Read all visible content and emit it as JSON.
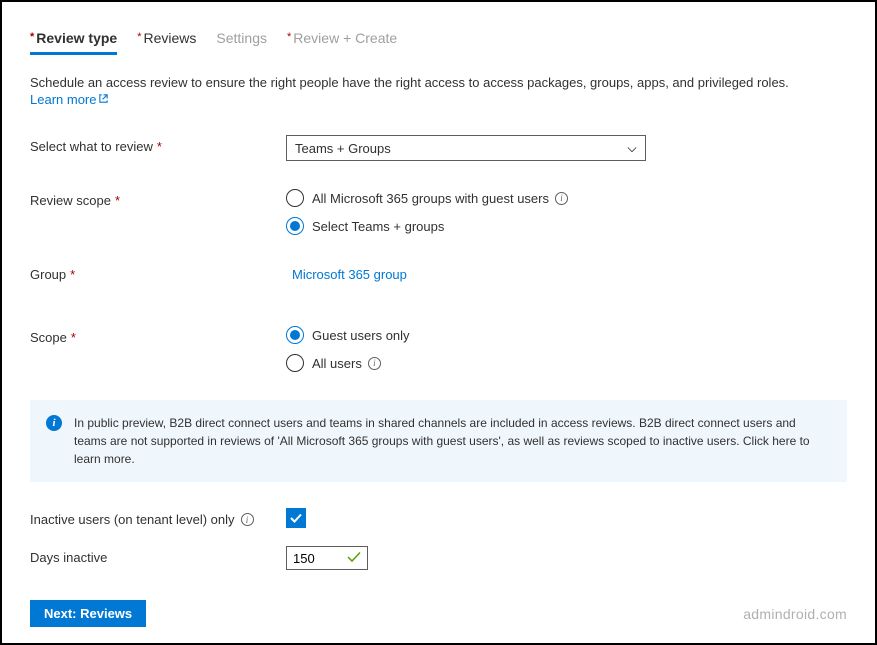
{
  "tabs": {
    "review_type": "Review type",
    "reviews": "Reviews",
    "settings": "Settings",
    "review_create": "Review + Create"
  },
  "description": "Schedule an access review to ensure the right people have the right access to access packages, groups, apps, and privileged roles.",
  "learn_more": "Learn more",
  "fields": {
    "select_what_label": "Select what to review",
    "select_what_value": "Teams + Groups",
    "review_scope_label": "Review scope",
    "review_scope_options": {
      "all_groups": "All Microsoft 365 groups with guest users",
      "select_teams": "Select Teams + groups"
    },
    "group_label": "Group",
    "group_value": "Microsoft 365 group",
    "scope_label": "Scope",
    "scope_options": {
      "guest_only": "Guest users only",
      "all_users": "All users"
    },
    "inactive_users_label": "Inactive users (on tenant level) only",
    "days_inactive_label": "Days inactive",
    "days_inactive_value": "150"
  },
  "banner_text": "In public preview, B2B direct connect users and teams in shared channels are included in access reviews. B2B direct connect users and teams are not supported in reviews of 'All Microsoft 365 groups with guest users', as well as reviews scoped to inactive users. Click here to learn more.",
  "footer": {
    "next_button": "Next: Reviews",
    "watermark": "admindroid.com"
  }
}
